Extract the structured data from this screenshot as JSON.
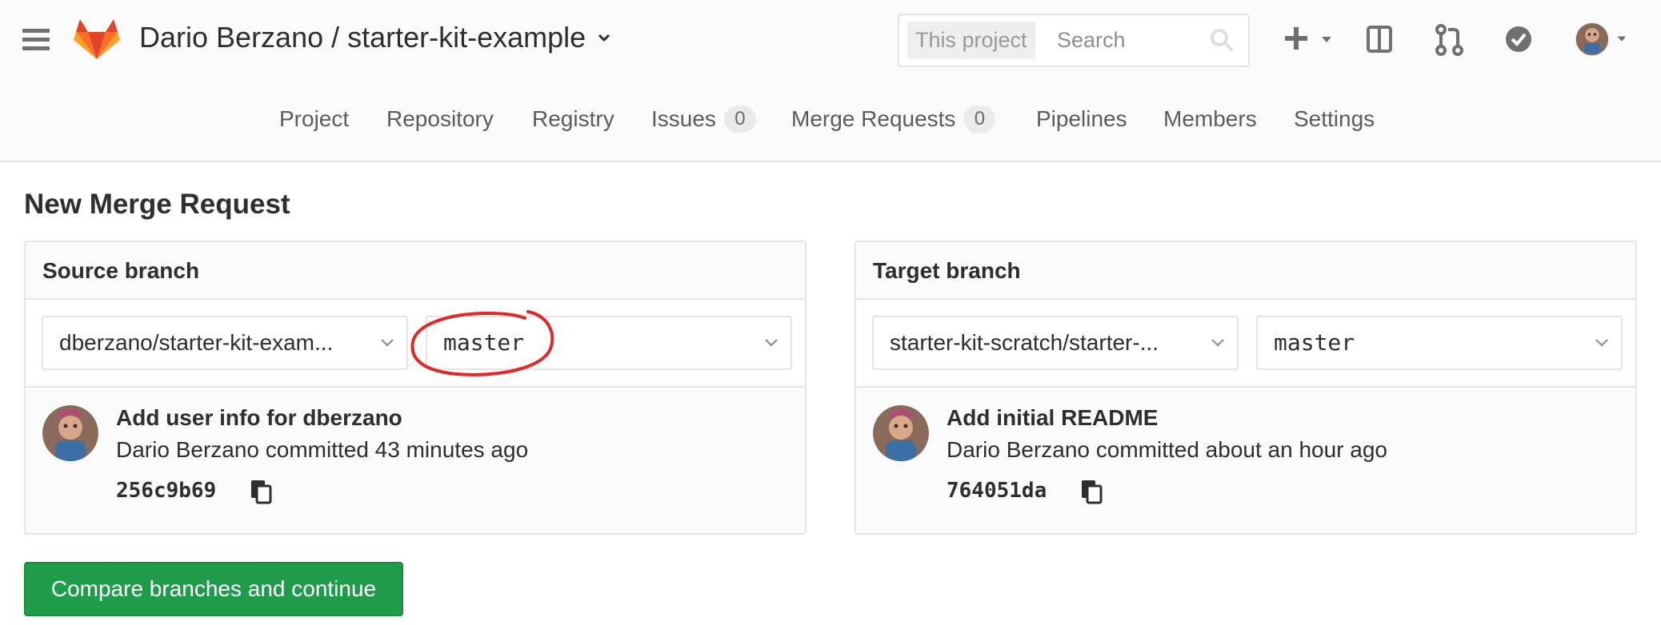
{
  "header": {
    "project_title": "Dario Berzano / starter-kit-example",
    "search": {
      "scope": "This project",
      "placeholder": "Search"
    }
  },
  "nav": {
    "items": [
      {
        "label": "Project"
      },
      {
        "label": "Repository"
      },
      {
        "label": "Registry"
      },
      {
        "label": "Issues",
        "count": "0"
      },
      {
        "label": "Merge Requests",
        "count": "0"
      },
      {
        "label": "Pipelines"
      },
      {
        "label": "Members"
      },
      {
        "label": "Settings"
      }
    ]
  },
  "page": {
    "title": "New Merge Request"
  },
  "source": {
    "title": "Source branch",
    "project": "dberzano/starter-kit-exam...",
    "branch": "master",
    "commit": {
      "message": "Add user info for dberzano",
      "meta": "Dario Berzano committed 43 minutes ago",
      "sha": "256c9b69"
    }
  },
  "target": {
    "title": "Target branch",
    "project": "starter-kit-scratch/starter-...",
    "branch": "master",
    "commit": {
      "message": "Add initial README",
      "meta": "Dario Berzano committed about an hour ago",
      "sha": "764051da"
    }
  },
  "actions": {
    "compare_label": "Compare branches and continue"
  },
  "colors": {
    "primary_green": "#1f9c4a",
    "annotation_red": "#e32626",
    "gitlab_orange": "#fc6d26",
    "gitlab_red": "#e24329",
    "gitlab_light": "#fca326"
  },
  "icons": [
    "menu-icon",
    "gitlab-logo",
    "chevron-down-icon",
    "search-icon",
    "plus-icon",
    "board-icon",
    "merge-request-icon",
    "todo-check-icon",
    "avatar",
    "copy-icon"
  ]
}
